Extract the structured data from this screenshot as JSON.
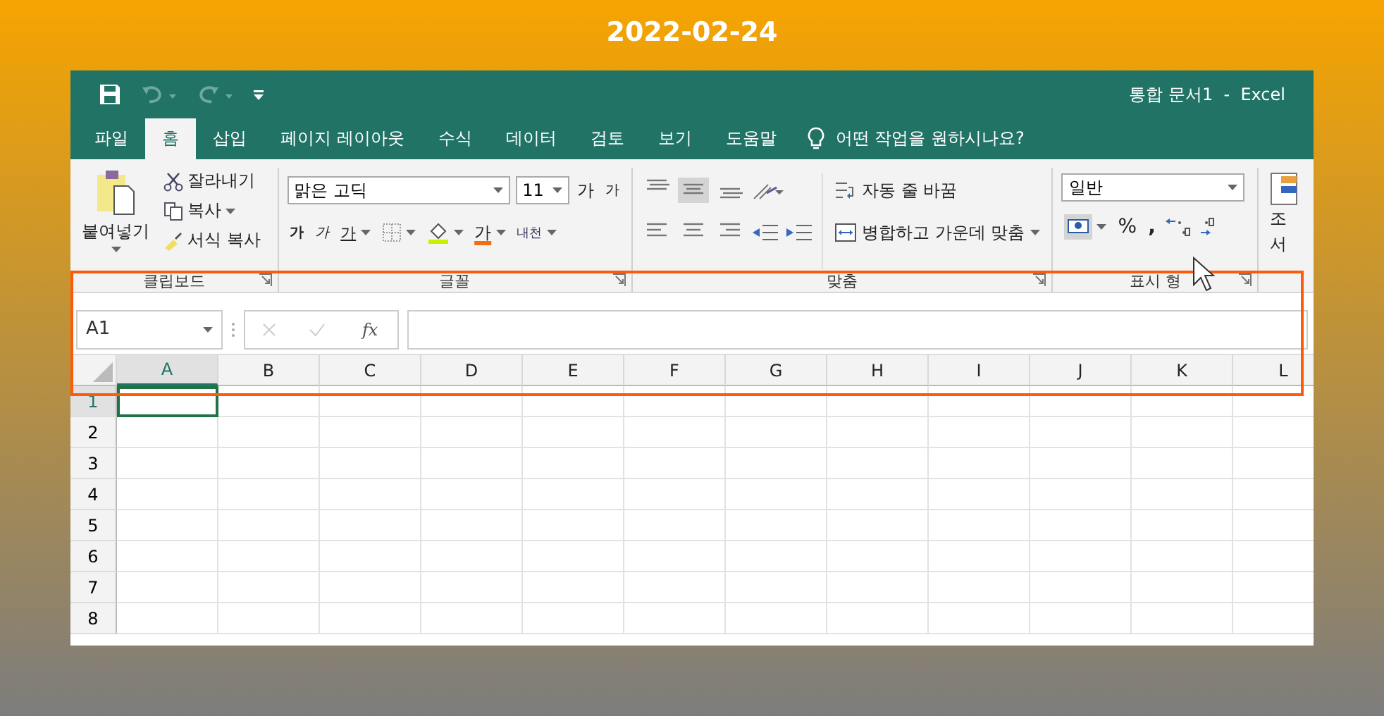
{
  "date": "2022-02-24",
  "window": {
    "title": "통합 문서1  -  Excel"
  },
  "tabs": [
    {
      "label": "파일",
      "selected": false
    },
    {
      "label": "홈",
      "selected": true
    },
    {
      "label": "삽입",
      "selected": false
    },
    {
      "label": "페이지 레이아웃",
      "selected": false
    },
    {
      "label": "수식",
      "selected": false
    },
    {
      "label": "데이터",
      "selected": false
    },
    {
      "label": "검토",
      "selected": false
    },
    {
      "label": "보기",
      "selected": false
    },
    {
      "label": "도움말",
      "selected": false
    }
  ],
  "tell_me": "어떤 작업을 원하시나요?",
  "ribbon": {
    "clipboard": {
      "paste": "붙여넣기",
      "cut": "잘라내기",
      "copy": "복사",
      "format_painter": "서식 복사",
      "label": "클립보드"
    },
    "font": {
      "name": "맑은 고딕",
      "size": "11",
      "grow": "가",
      "shrink": "가",
      "bold": "가",
      "italic": "가",
      "underline": "가",
      "font_color": "가",
      "phonetic": "내천",
      "label": "글꼴"
    },
    "alignment": {
      "wrap": "자동 줄 바꿈",
      "merge": "병합하고 가운데 맞춤",
      "label": "맞춤"
    },
    "number": {
      "format": "일반",
      "percent": "%",
      "comma": ",",
      "label": "표시 형"
    },
    "styles": {
      "lines": [
        "조",
        "서"
      ]
    }
  },
  "formula_bar": {
    "name_box": "A1",
    "function_label": "fx"
  },
  "columns": [
    {
      "label": "A",
      "selected": true
    },
    {
      "label": "B",
      "selected": false
    },
    {
      "label": "C",
      "selected": false
    },
    {
      "label": "D",
      "selected": false
    },
    {
      "label": "E",
      "selected": false
    },
    {
      "label": "F",
      "selected": false
    },
    {
      "label": "G",
      "selected": false
    },
    {
      "label": "H",
      "selected": false
    },
    {
      "label": "I",
      "selected": false
    },
    {
      "label": "J",
      "selected": false
    },
    {
      "label": "K",
      "selected": false
    },
    {
      "label": "L",
      "selected": false
    }
  ],
  "rows": [
    {
      "label": "1",
      "selected": true
    },
    {
      "label": "2",
      "selected": false
    },
    {
      "label": "3",
      "selected": false
    },
    {
      "label": "4",
      "selected": false
    },
    {
      "label": "5",
      "selected": false
    },
    {
      "label": "6",
      "selected": false
    },
    {
      "label": "7",
      "selected": false
    },
    {
      "label": "8",
      "selected": false
    }
  ]
}
